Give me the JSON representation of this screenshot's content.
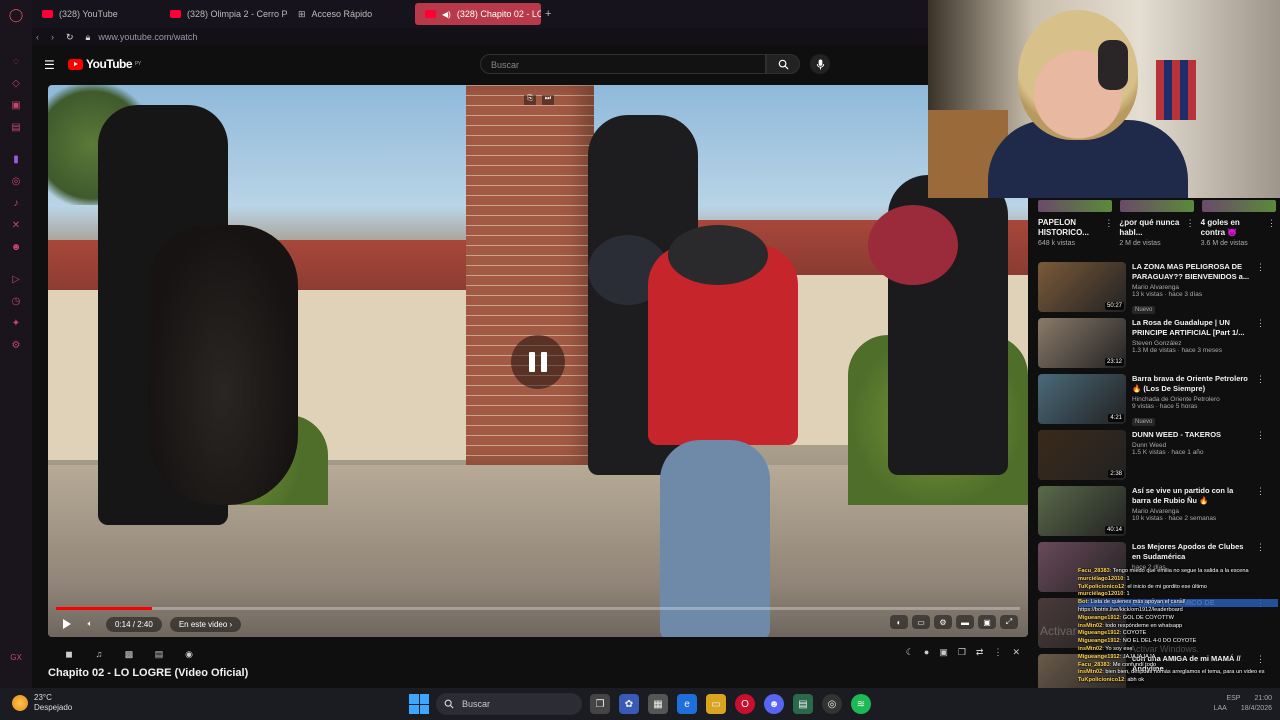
{
  "browser": {
    "tabs": [
      {
        "label": "(328) YouTube",
        "active": false
      },
      {
        "label": "(328) Olimpia 2 - Cerro Po",
        "active": false
      },
      {
        "label": "Acceso Rápido",
        "active": false
      },
      {
        "label": "(328) Chapito 02 - LO",
        "active": true
      }
    ],
    "new_tab": "+",
    "url": "www.youtube.com/watch"
  },
  "youtube": {
    "logo_text": "YouTube",
    "logo_region": "PY",
    "search_placeholder": "Buscar"
  },
  "player": {
    "time": "0:14 / 2:40",
    "chapter_chip": "En este video",
    "progress_fraction": 0.1
  },
  "video_title": "Chapito 02 - LO LOGRE (Video Oficial)",
  "shorts": [
    {
      "title": "PAPELON HISTORICO...",
      "views": "648 k vistas"
    },
    {
      "title": "¿por qué nunca habl...",
      "views": "2 M de vistas"
    },
    {
      "title": "4 goles en contra 😈",
      "views": "3.6 M de vistas"
    }
  ],
  "related": [
    {
      "title": "LA ZONA MAS PELIGROSA DE PARAGUAY?? BIENVENIDOS a...",
      "channel": "Mario Alvarenga",
      "views": "13 k vistas · hace 3 días",
      "badge": "Nuevo",
      "duration": "50:27",
      "thumb": "#7a5a3a"
    },
    {
      "title": "La Rosa de Guadalupe | UN PRINCIPE ARTIFICIAL [Part 1/...",
      "channel": "Steven González",
      "views": "1.3 M de vistas · hace 3 meses",
      "badge": "",
      "duration": "23:12",
      "thumb": "#8a7a6a"
    },
    {
      "title": "Barra brava de Oriente Petrolero 🔥 (Los De Siempre)",
      "channel": "Hinchada de Oriente Petrolero",
      "views": "9 vistas · hace 5 horas",
      "badge": "Nuevo",
      "duration": "4:21",
      "thumb": "#4a6a7a"
    },
    {
      "title": "DUNN WEED - TAKEROS",
      "channel": "Dunn Weed",
      "views": "1.5 K vistas · hace 1 año",
      "badge": "",
      "duration": "2:38",
      "thumb": "#3a2a1a"
    },
    {
      "title": "Así se vive un partido con la barra de Rubio Ñu 🔥",
      "channel": "Mario Alvarenga",
      "views": "10 k vistas · hace 2 semanas",
      "badge": "",
      "duration": "40:14",
      "thumb": "#5a6a4a"
    },
    {
      "title": "Los Mejores Apodos de Clubes en Sudamérica",
      "channel": "",
      "views": "hace 2 días",
      "badge": "",
      "duration": "",
      "thumb": "#6a4a5a"
    },
    {
      "title": "EL MÁS POLÉMICO DE",
      "channel": "",
      "views": "",
      "badge": "",
      "duration": "",
      "thumb": "#4a3a3a"
    },
    {
      "title": "con una AMIGA de mi MAMÁ // Andyline",
      "channel": "",
      "views": "",
      "badge": "",
      "duration": "",
      "thumb": "#6a5a4a"
    }
  ],
  "chat": [
    {
      "user": "Facu_28383",
      "msg": "Tengo miedo que emilia no segue la salida a la escena"
    },
    {
      "user": "murciélago12010",
      "msg": "1"
    },
    {
      "user": "TuKpolicíonico12",
      "msg": "el inicio de mi gordito ese último"
    },
    {
      "user": "murciélago12010",
      "msg": "1"
    },
    {
      "user": "Bot",
      "msg": "Lista de quienes más apoyan el canal!"
    },
    {
      "user": "",
      "msg": "https://botrix.live/kick/om1912/leaderboard"
    },
    {
      "user": "Migueange1912",
      "msg": "GOL DE COYOTTW"
    },
    {
      "user": "insMtn02",
      "msg": "todo respóndeme en whatsapp"
    },
    {
      "user": "Migueange1912",
      "msg": "COYOTE"
    },
    {
      "user": "Migueange1912",
      "msg": "NO EL DEL 4-0 DO COYOTE"
    },
    {
      "user": "insMtn02",
      "msg": "Yo soy ese"
    },
    {
      "user": "Migueange1912",
      "msg": "JAJAJAJAJA"
    },
    {
      "user": "Facu_28383",
      "msg": "Me confundí todo"
    },
    {
      "user": "insMtn02",
      "msg": "bien bien, después nomás arreglamos el tema, para un video es"
    },
    {
      "user": "TuKpolicíonico12",
      "msg": "abh ok"
    }
  ],
  "watermark": {
    "line1": "Activar",
    "line2": "Activar Windows."
  },
  "taskbar": {
    "temperature": "23°C",
    "condition": "Despejado",
    "search": "Buscar",
    "lang": "ESP",
    "lang2": "LAA",
    "time": "21:00",
    "date": "18/4/2026"
  },
  "colors": {
    "accent_red": "#ff0000",
    "tab_active": "#b83a4a",
    "taskbar": "#1b1b22"
  }
}
